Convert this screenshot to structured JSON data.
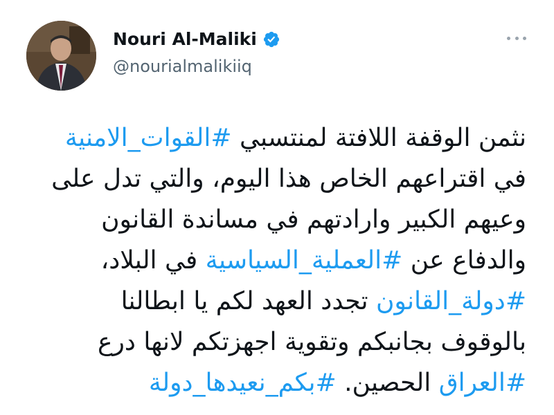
{
  "profile": {
    "name": "Nouri Al-Maliki",
    "handle": "@nourialmalikiiq",
    "verified_icon": "verified-badge-icon",
    "more_icon": "more-options-icon",
    "accent_color": "#1d9bf0"
  },
  "tweet": {
    "lines": [
      [
        {
          "text": "نثمن الوقفة اللافتة لمنتسبي ",
          "tag": false
        },
        {
          "text": "#القوات_الامنية",
          "tag": true
        }
      ],
      [
        {
          "text": "في اقتراعهم الخاص هذا اليوم، والتي تدل على",
          "tag": false
        }
      ],
      [
        {
          "text": "وعيهم الكبير وارادتهم في مساندة القانون",
          "tag": false
        }
      ],
      [
        {
          "text": "والدفاع عن ",
          "tag": false
        },
        {
          "text": "#العملية_السياسية",
          "tag": true
        },
        {
          "text": " في البلاد،",
          "tag": false
        }
      ],
      [
        {
          "text": "#دولة_القانون",
          "tag": true
        },
        {
          "text": " تجدد العهد لكم يا ابطالنا",
          "tag": false
        }
      ],
      [
        {
          "text": "بالوقوف بجانبكم وتقوية اجهزتكم لانها درع",
          "tag": false
        }
      ],
      [
        {
          "text": "#العراق",
          "tag": true
        },
        {
          "text": " الحصين. ",
          "tag": false
        },
        {
          "text": "#بكم_نعيدها_دولة",
          "tag": true
        }
      ]
    ]
  }
}
